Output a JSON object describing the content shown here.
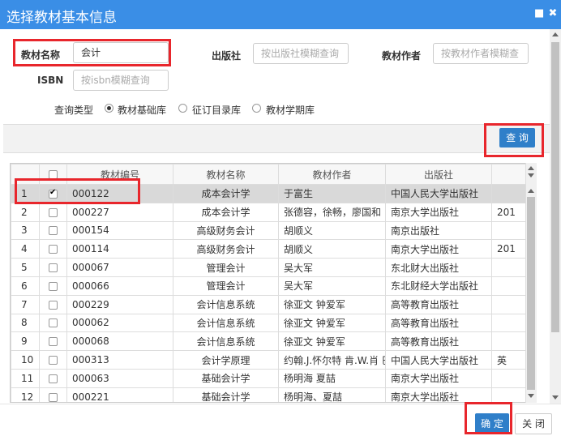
{
  "dialog": {
    "title": "选择教材基本信息"
  },
  "form": {
    "name_label": "教材名称",
    "name_value": "会计",
    "publisher_label": "出版社",
    "publisher_placeholder": "按出版社模糊查询",
    "author_label": "教材作者",
    "author_placeholder": "按教材作者模糊查",
    "isbn_label": "ISBN",
    "isbn_placeholder": "按isbn模糊查询",
    "query_type_label": "查询类型",
    "query_types": [
      "教材基础库",
      "征订目录库",
      "教材学期库"
    ],
    "selected_query_type": "教材基础库"
  },
  "toolbar": {
    "query_button": "查 询"
  },
  "table": {
    "columns": [
      "",
      "",
      "教材编号",
      "教材名称",
      "教材作者",
      "出版社",
      ""
    ],
    "rows": [
      {
        "no": "1",
        "checked": true,
        "code": "000122",
        "name": "成本会计学",
        "author": "于富生",
        "publisher": "中国人民大学出版社",
        "extra": ""
      },
      {
        "no": "2",
        "checked": false,
        "code": "000227",
        "name": "成本会计学",
        "author": "张德容，徐畅，廖国和",
        "publisher": "南京大学出版社",
        "extra": "201"
      },
      {
        "no": "3",
        "checked": false,
        "code": "000154",
        "name": "高级财务会计",
        "author": "胡顺义",
        "publisher": "南京出版社",
        "extra": ""
      },
      {
        "no": "4",
        "checked": false,
        "code": "000114",
        "name": "高级财务会计",
        "author": "胡顺义",
        "publisher": "南京大学出版社",
        "extra": "201"
      },
      {
        "no": "5",
        "checked": false,
        "code": "000067",
        "name": "管理会计",
        "author": "吴大军",
        "publisher": "东北财大出版社",
        "extra": ""
      },
      {
        "no": "6",
        "checked": false,
        "code": "000066",
        "name": "管理会计",
        "author": "吴大军",
        "publisher": "东北财经大学出版社",
        "extra": ""
      },
      {
        "no": "7",
        "checked": false,
        "code": "000229",
        "name": "会计信息系统",
        "author": "徐亚文 钟爱军",
        "publisher": "高等教育出版社",
        "extra": ""
      },
      {
        "no": "8",
        "checked": false,
        "code": "000062",
        "name": "会计信息系统",
        "author": "徐亚文 钟爱军",
        "publisher": "高等教育出版社",
        "extra": ""
      },
      {
        "no": "9",
        "checked": false,
        "code": "000068",
        "name": "会计信息系统",
        "author": "徐亚文 钟爱军",
        "publisher": "高等教育出版社",
        "extra": ""
      },
      {
        "no": "10",
        "checked": false,
        "code": "000313",
        "name": "会计学原理",
        "author": "约翰.J.怀尔特 肯.W.肖 巴",
        "publisher": "中国人民大学出版社",
        "extra": "英"
      },
      {
        "no": "11",
        "checked": false,
        "code": "000063",
        "name": "基础会计学",
        "author": "杨明海 夏喆",
        "publisher": "南京大学出版社",
        "extra": ""
      },
      {
        "no": "12",
        "checked": false,
        "code": "000221",
        "name": "基础会计学",
        "author": "杨明海、夏喆",
        "publisher": "南京大学出版社",
        "extra": ""
      }
    ]
  },
  "footer": {
    "confirm_button": "确 定",
    "close_button": "关 闭"
  },
  "colors": {
    "title_bar": "#3a8ee6",
    "primary_button": "#2f7fc9",
    "highlight_box": "#e8262c",
    "selected_row": "#d9d9d9"
  }
}
